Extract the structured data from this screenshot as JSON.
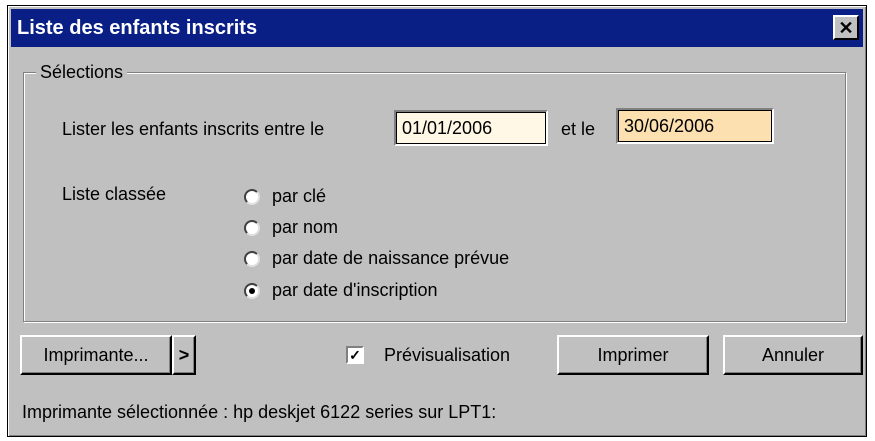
{
  "window": {
    "title": "Liste des enfants inscrits",
    "close_glyph": "✕"
  },
  "selections": {
    "legend": "Sélections",
    "range_label": "Lister les enfants inscrits entre le",
    "start_date": "01/01/2006",
    "between_label": "et le",
    "end_date": "30/06/2006",
    "start_bg": "#fff8e6",
    "end_bg": "#fde0b0",
    "sort_label": "Liste classée",
    "sort_options": [
      {
        "label": "par clé",
        "checked": false
      },
      {
        "label": "par nom",
        "checked": false
      },
      {
        "label": "par date de naissance prévue",
        "checked": false
      },
      {
        "label": "par date d'inscription",
        "checked": true
      }
    ]
  },
  "footer": {
    "printer_button": "Imprimante...",
    "printer_arrow": ">",
    "preview_label": "Prévisualisation",
    "preview_checked": true,
    "print_button": "Imprimer",
    "cancel_button": "Annuler",
    "selected_printer": "Imprimante sélectionnée : hp deskjet 6122 series sur LPT1:"
  }
}
